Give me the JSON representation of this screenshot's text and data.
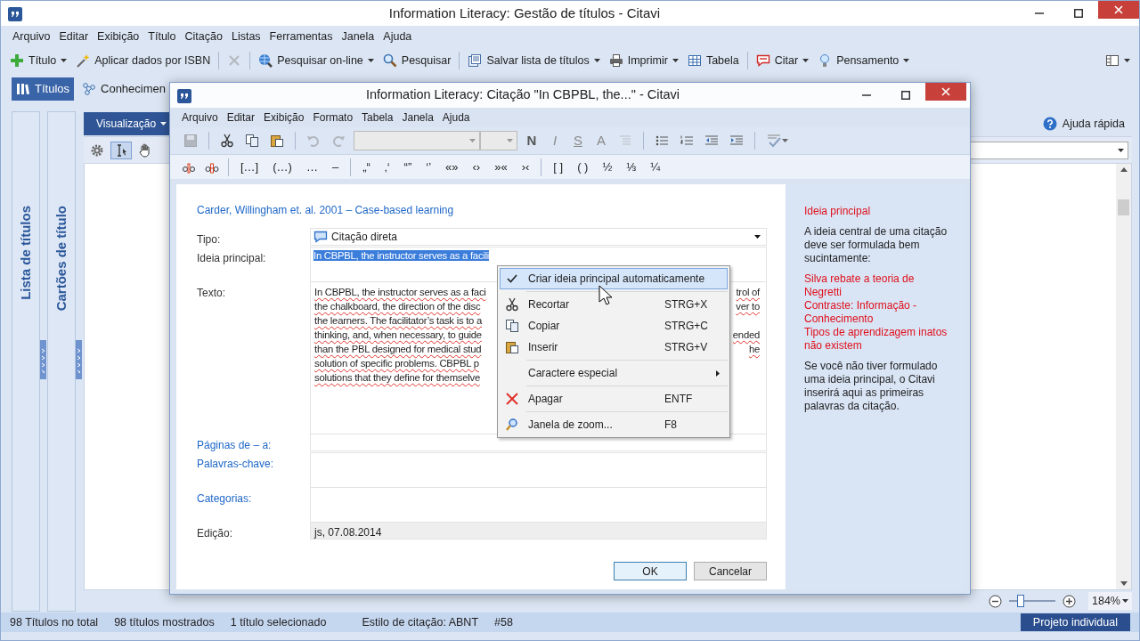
{
  "window": {
    "title": "Information Literacy: Gestão de títulos - Citavi"
  },
  "menu": [
    "Arquivo",
    "Editar",
    "Exibição",
    "Título",
    "Citação",
    "Listas",
    "Ferramentas",
    "Janela",
    "Ajuda"
  ],
  "toolbar": [
    {
      "label": "Título",
      "dropdown": true,
      "disabled": false,
      "separator_before": false
    },
    {
      "label": "Aplicar dados por ISBN",
      "dropdown": false,
      "disabled": false,
      "separator_before": false
    },
    {
      "dropdown": false,
      "disabled": true,
      "separator_before": true
    },
    {
      "label": "Pesquisar on-line",
      "dropdown": true,
      "disabled": false,
      "separator_before": true
    },
    {
      "label": "Pesquisar",
      "dropdown": false,
      "disabled": false,
      "separator_before": false
    },
    {
      "label": "Salvar lista de títulos",
      "dropdown": true,
      "disabled": false,
      "separator_before": true
    },
    {
      "label": "Imprimir",
      "dropdown": true,
      "disabled": false,
      "separator_before": false
    },
    {
      "label": "Tabela",
      "dropdown": false,
      "disabled": false,
      "separator_before": false
    },
    {
      "label": "Citar",
      "dropdown": true,
      "disabled": false,
      "separator_before": true
    },
    {
      "label": "Pensamento",
      "dropdown": true,
      "disabled": false,
      "separator_before": false
    }
  ],
  "tabs": [
    {
      "label": "Títulos",
      "selected": true
    },
    {
      "label": "Conhecimen",
      "selected": false
    }
  ],
  "side_panels": [
    {
      "label": "Lista de títulos"
    },
    {
      "label": "Cartões de título"
    }
  ],
  "view_button": {
    "label": "Visualização"
  },
  "quick_help": {
    "label": "Ajuda rápida"
  },
  "zoom": {
    "level": 0.25,
    "value": "184%"
  },
  "status_bar": {
    "items": [
      "98 Títulos no total",
      "98 títulos mostrados",
      "1 título selecionado",
      "Estilo de citação: ABNT",
      "#58"
    ],
    "project": "Projeto individual"
  },
  "dialog": {
    "title": "Information Literacy: Citação \"In CBPBL, the...\" - Citavi",
    "menu": [
      "Arquivo",
      "Editar",
      "Exibição",
      "Formato",
      "Tabela",
      "Janela",
      "Ajuda"
    ],
    "format_buttons": [
      "N",
      "I",
      "S",
      "A"
    ],
    "insert_groups": [
      [
        "[…]",
        "(…)",
        "…",
        "–"
      ],
      [
        "„“",
        "‚‘",
        "“”",
        "‘’",
        "«»",
        "‹›",
        "»«",
        "›‹"
      ],
      [
        "[ ]",
        "( )",
        "½",
        "⅓",
        "¼"
      ]
    ],
    "reference": "Carder, Willingham et. al. 2001 – Case-based learning",
    "fields": [
      {
        "label": "Tipo:",
        "kind": "dropdown",
        "link": false,
        "value": "Citação direta"
      },
      {
        "label": "Ideia principal:",
        "kind": "selection",
        "link": false,
        "value": "In CBPBL, the instructor serves as a facili"
      },
      {
        "label": "Texto:",
        "kind": "text",
        "link": false,
        "lines": [
          {
            "left": "In CBPBL, the instructor serves as a faci",
            "right": "trol of"
          },
          {
            "left": "the chalkboard, the direction of the disc",
            "right": "ver to"
          },
          {
            "left": "the learners. The facilitator’s task is to a"
          },
          {
            "left": "thinking, and, when necessary, to guide",
            "right": "ended"
          },
          {
            "left": "than the PBL designed for medical stud",
            "right": "he"
          },
          {
            "left": "solution of specific problems. CBPBL p"
          },
          {
            "left": "solutions that they define for themselve"
          }
        ]
      },
      {
        "label": "Páginas de – a:",
        "kind": "line",
        "link": true
      },
      {
        "label": "Palavras-chave:",
        "kind": "box",
        "link": true
      },
      {
        "label": "Categorias:",
        "kind": "box",
        "link": true
      },
      {
        "label": "Edição:",
        "kind": "readonly",
        "link": false,
        "value": "js, 07.08.2014"
      }
    ],
    "buttons": [
      {
        "label": "OK",
        "default": true
      },
      {
        "label": "Cancelar",
        "default": false
      }
    ],
    "help": {
      "title": "Ideia principal",
      "intro": "A ideia central de uma citação deve ser formulada bem sucintamente:",
      "examples": [
        "Silva rebate a teoria de Negretti",
        "Contraste: Informação - Conhecimento",
        "Tipos de aprendizagem inatos não existem"
      ],
      "note": "Se você não tiver formulado uma ideia principal, o Citavi inserirá aqui as primeiras palavras da citação."
    }
  },
  "context_menu": {
    "items": [
      {
        "label": "Criar ideia principal automaticamente",
        "checked": true,
        "selected": true,
        "submenu": false,
        "separator_before": false
      },
      {
        "label": "Recortar",
        "shortcut": "STRG+X",
        "checked": false,
        "selected": false,
        "submenu": false,
        "separator_before": true
      },
      {
        "label": "Copiar",
        "shortcut": "STRG+C",
        "checked": false,
        "selected": false,
        "submenu": false,
        "separator_before": false
      },
      {
        "label": "Inserir",
        "shortcut": "STRG+V",
        "checked": false,
        "selected": false,
        "submenu": false,
        "separator_before": false
      },
      {
        "label": "Caractere especial",
        "checked": false,
        "selected": false,
        "submenu": true,
        "separator_before": true
      },
      {
        "label": "Apagar",
        "shortcut": "ENTF",
        "checked": false,
        "selected": false,
        "submenu": false,
        "separator_before": true
      },
      {
        "label": "Janela de zoom...",
        "shortcut": "F8",
        "checked": false,
        "selected": false,
        "submenu": false,
        "separator_before": true
      }
    ]
  }
}
